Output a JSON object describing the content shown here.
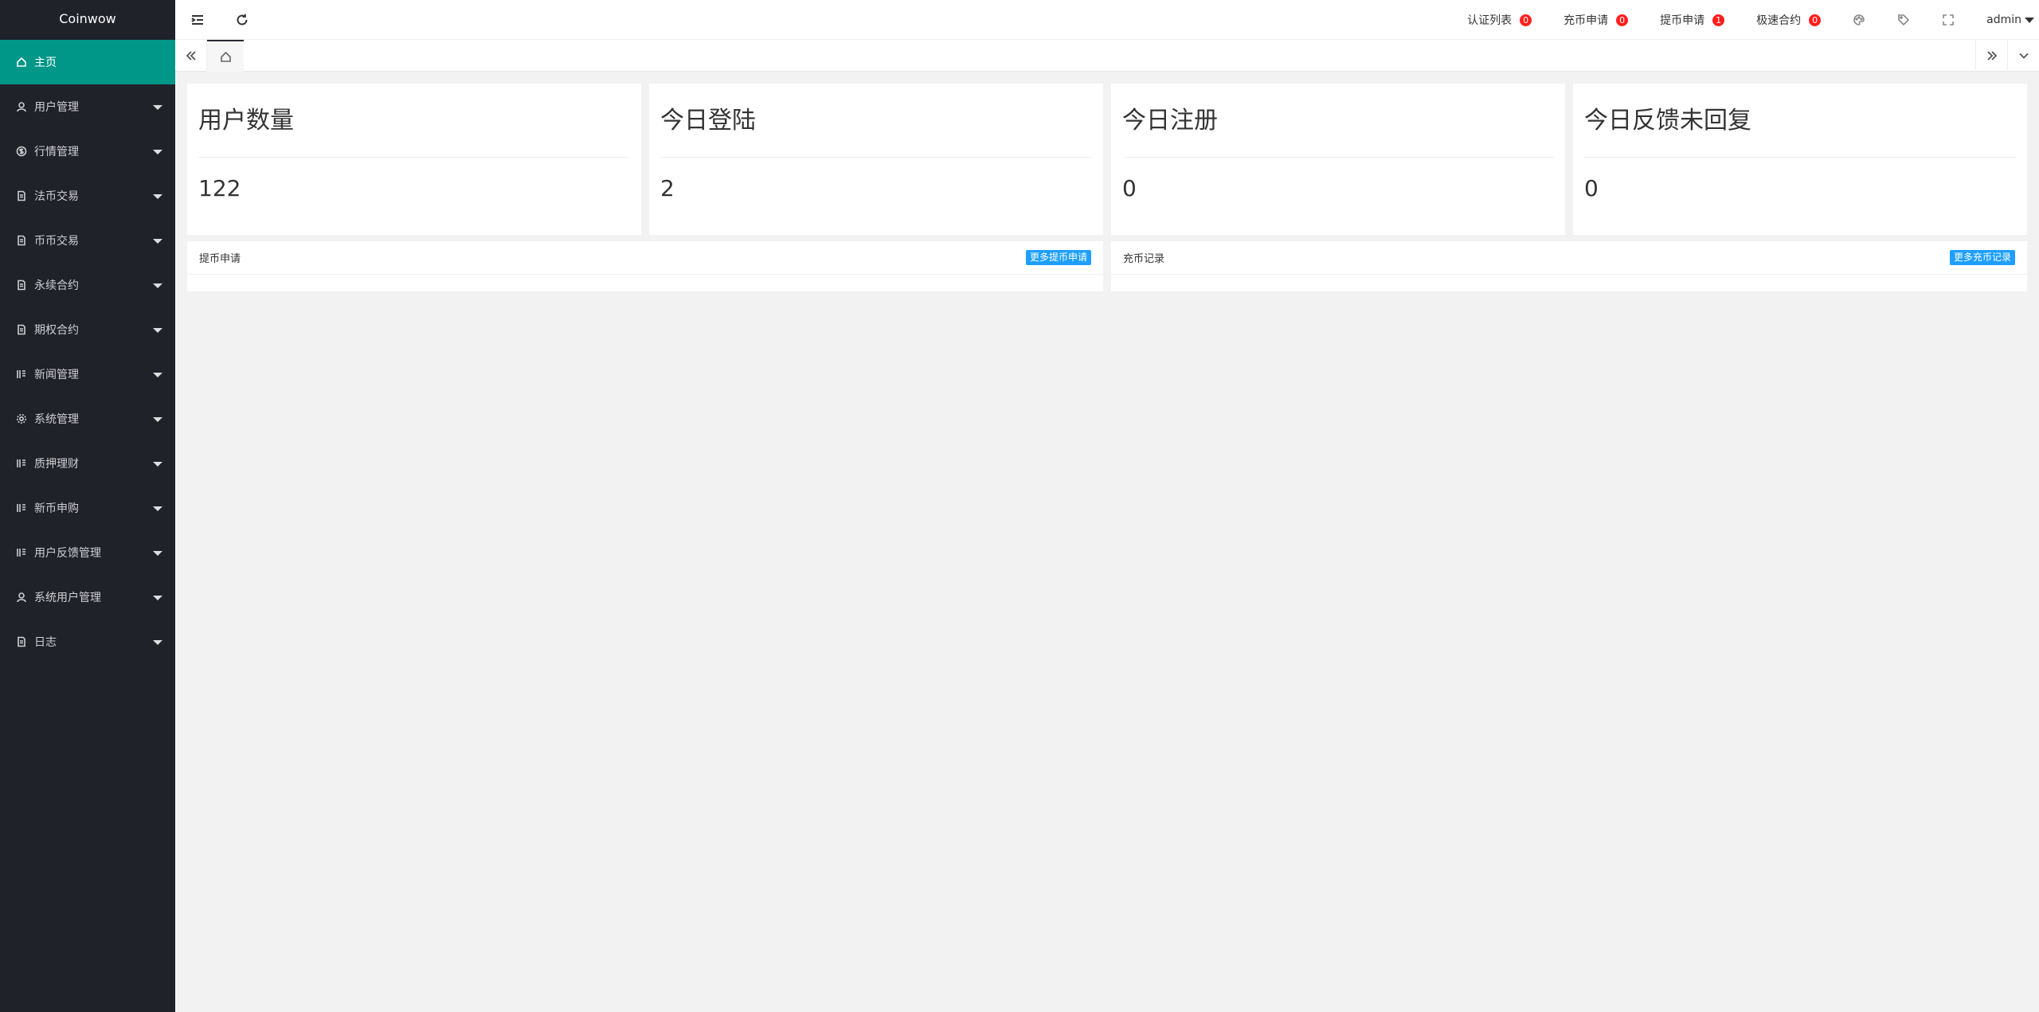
{
  "app": {
    "logo": "Coinwow"
  },
  "sidebar": {
    "items": [
      {
        "label": "主页",
        "icon": "home-icon",
        "active": true
      },
      {
        "label": "用户管理",
        "icon": "user-icon"
      },
      {
        "label": "行情管理",
        "icon": "dollar-icon"
      },
      {
        "label": "法币交易",
        "icon": "file-icon"
      },
      {
        "label": "币币交易",
        "icon": "file-icon"
      },
      {
        "label": "永续合约",
        "icon": "file-icon"
      },
      {
        "label": "期权合约",
        "icon": "file-icon"
      },
      {
        "label": "新闻管理",
        "icon": "list-icon"
      },
      {
        "label": "系统管理",
        "icon": "gear-icon"
      },
      {
        "label": "质押理财",
        "icon": "list-icon"
      },
      {
        "label": "新币申购",
        "icon": "list-icon"
      },
      {
        "label": "用户反馈管理",
        "icon": "list-icon"
      },
      {
        "label": "系统用户管理",
        "icon": "user-icon"
      },
      {
        "label": "日志",
        "icon": "file-icon"
      }
    ]
  },
  "header": {
    "links": [
      {
        "label": "认证列表",
        "count": "0"
      },
      {
        "label": "充币申请",
        "count": "0"
      },
      {
        "label": "提币申请",
        "count": "1"
      },
      {
        "label": "极速合约",
        "count": "0"
      }
    ],
    "user": "admin"
  },
  "stats": [
    {
      "title": "用户数量",
      "value": "122"
    },
    {
      "title": "今日登陆",
      "value": "2"
    },
    {
      "title": "今日注册",
      "value": "0"
    },
    {
      "title": "今日反馈未回复",
      "value": "0"
    }
  ],
  "panels": [
    {
      "title": "提币申请",
      "button": "更多提币申请"
    },
    {
      "title": "充币记录",
      "button": "更多充币记录"
    }
  ],
  "colors": {
    "accent": "#009688",
    "sidebar": "#20222a",
    "badge": "#ff1e1e",
    "button": "#1e9fff"
  }
}
